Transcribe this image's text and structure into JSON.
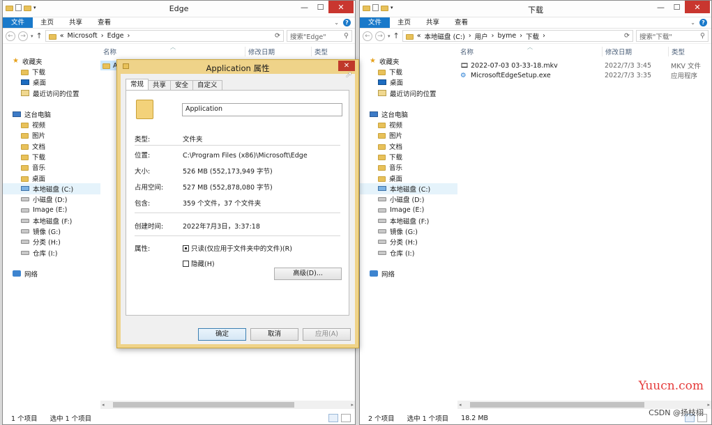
{
  "left_window": {
    "title": "Edge",
    "ribbon_tabs": [
      "文件",
      "主页",
      "共享",
      "查看"
    ],
    "breadcrumb": [
      "«",
      "Microsoft",
      "›",
      "Edge",
      "›"
    ],
    "search_placeholder": "搜索\"Edge\"",
    "columns": [
      "名称",
      "修改日期",
      "类型"
    ],
    "files": [
      {
        "name": "A",
        "date": "",
        "type": ""
      }
    ],
    "status": {
      "items": "1 个项目",
      "selected": "选中 1 个项目"
    }
  },
  "right_window": {
    "title": "下载",
    "ribbon_tabs": [
      "文件",
      "主页",
      "共享",
      "查看"
    ],
    "breadcrumb": [
      "«",
      "本地磁盘 (C:)",
      "›",
      "用户",
      "›",
      "byme",
      "›",
      "下载",
      "›"
    ],
    "search_placeholder": "搜索\"下载\"",
    "columns": [
      "名称",
      "修改日期",
      "类型"
    ],
    "files": [
      {
        "name": "2022-07-03 03-33-18.mkv",
        "date": "2022/7/3 3:45",
        "type": "MKV 文件"
      },
      {
        "name": "MicrosoftEdgeSetup.exe",
        "date": "2022/7/3 3:35",
        "type": "应用程序"
      }
    ],
    "status": {
      "items": "2 个项目",
      "selected": "选中 1 个项目",
      "size": "18.2 MB"
    }
  },
  "nav": {
    "favorites": "收藏夹",
    "fav_items": [
      "下载",
      "桌面",
      "最近访问的位置"
    ],
    "pc": "这台电脑",
    "pc_items": [
      "视频",
      "图片",
      "文档",
      "下载",
      "音乐",
      "桌面",
      "本地磁盘 (C:)",
      "小磁盘 (D:)",
      "Image (E:)",
      "本地磁盘 (F:)",
      "镜像 (G:)",
      "分类 (H:)",
      "仓库 (I:)"
    ],
    "network": "网络"
  },
  "dialog": {
    "title": "Application 属性",
    "tabs": [
      "常规",
      "共享",
      "安全",
      "自定义"
    ],
    "name": "Application",
    "type_label": "类型:",
    "type_value": "文件夹",
    "location_label": "位置:",
    "location_value": "C:\\Program Files (x86)\\Microsoft\\Edge",
    "size_label": "大小:",
    "size_value": "526 MB (552,173,949 字节)",
    "disk_label": "占用空间:",
    "disk_value": "527 MB (552,878,080 字节)",
    "contains_label": "包含:",
    "contains_value": "359 个文件，37 个文件夹",
    "created_label": "创建时间:",
    "created_value": "2022年7月3日，3:37:18",
    "attr_label": "属性:",
    "readonly_label": "只读(仅应用于文件夹中的文件)(R)",
    "hidden_label": "隐藏(H)",
    "advanced_label": "高级(D)...",
    "ok_label": "确定",
    "cancel_label": "取消",
    "apply_label": "应用(A)"
  },
  "watermark": "Yuucn.com",
  "csdn": "CSDN @扬枝栩"
}
